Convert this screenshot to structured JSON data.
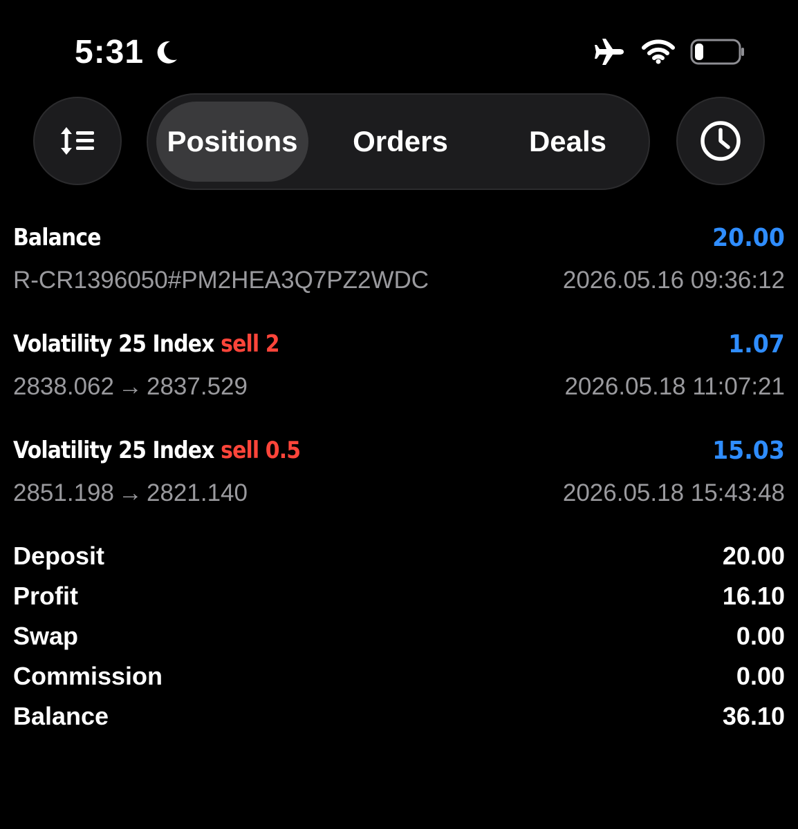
{
  "status_bar": {
    "time": "5:31",
    "focus_icon": "moon-icon",
    "icons": [
      "airplane-icon",
      "wifi-icon",
      "battery-icon"
    ],
    "battery_level": 0.2
  },
  "toolbar": {
    "sort_icon": "sort-icon",
    "history_icon": "clock-icon",
    "tabs": [
      {
        "label": "Positions",
        "active": true
      },
      {
        "label": "Orders",
        "active": false
      },
      {
        "label": "Deals",
        "active": false
      }
    ]
  },
  "entries": [
    {
      "title": "Balance",
      "subtitle": "R-CR1396050#PM2HEA3Q7PZ2WDC",
      "amount": "20.00",
      "time": "2026.05.16 09:36:12"
    },
    {
      "title": "Volatility 25 Index",
      "operation": "sell 2",
      "open_price": "2838.062",
      "close_price": "2837.529",
      "arrow": "→",
      "amount": "1.07",
      "time": "2026.05.18 11:07:21"
    },
    {
      "title": "Volatility 25 Index",
      "operation": "sell 0.5",
      "open_price": "2851.198",
      "close_price": "2821.140",
      "arrow": "→",
      "amount": "15.03",
      "time": "2026.05.18 15:43:48"
    }
  ],
  "summary": [
    {
      "label": "Deposit",
      "value": "20.00"
    },
    {
      "label": "Profit",
      "value": "16.10"
    },
    {
      "label": "Swap",
      "value": "0.00"
    },
    {
      "label": "Commission",
      "value": "0.00"
    },
    {
      "label": "Balance",
      "value": "36.10"
    }
  ],
  "colors": {
    "background": "#000000",
    "accent_blue": "#2f8dff",
    "sell_red": "#ff453a",
    "secondary_text": "#9a9a9e",
    "control_bg": "#1c1c1e",
    "active_tab_bg": "#3a3a3c"
  }
}
